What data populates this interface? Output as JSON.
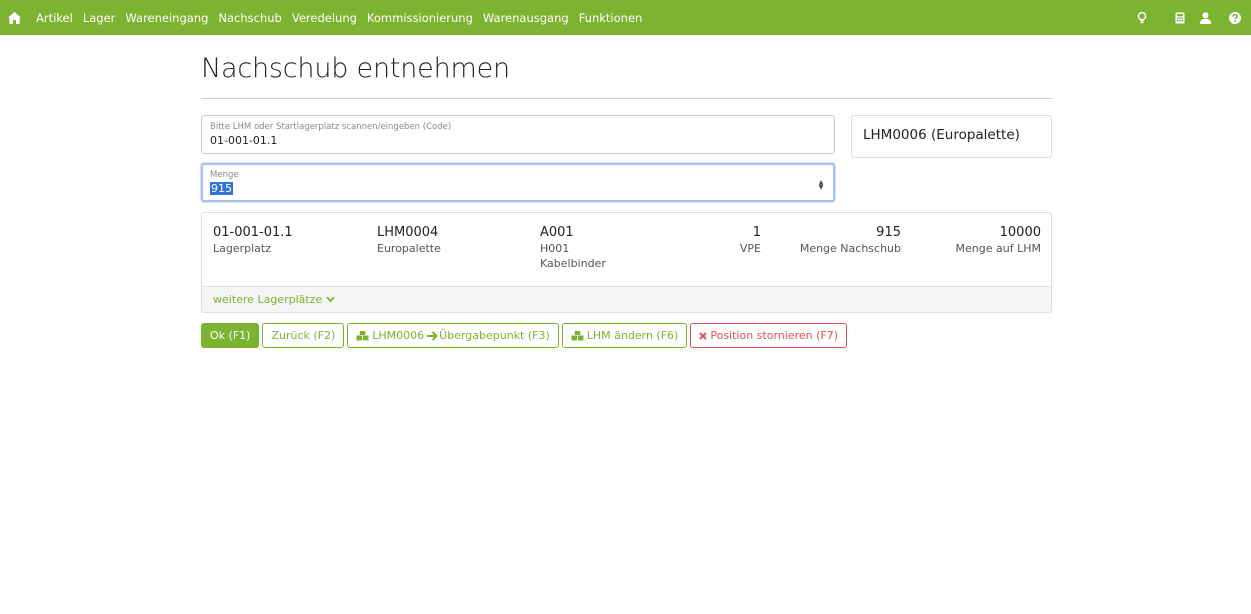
{
  "navbar": {
    "home_icon": "home-icon",
    "items": [
      "Artikel",
      "Lager",
      "Wareneingang",
      "Nachschub",
      "Veredelung",
      "Kommissionierung",
      "Warenausgang",
      "Funktionen"
    ],
    "right_icons": [
      "lightbulb-icon",
      "calculator-icon",
      "user-icon",
      "help-icon"
    ],
    "color": "#7cb330"
  },
  "page": {
    "title": "Nachschub entnehmen"
  },
  "scan_field": {
    "label": "Bitte LHM oder Startlagerplatz scannen/eingeben (Code)",
    "value": "01-001-01.1"
  },
  "menge_field": {
    "label": "Menge",
    "value": "915"
  },
  "lhm_box": {
    "text": "LHM0006 (Europalette)"
  },
  "position": {
    "lagerplatz": "01-001-01.1",
    "lagerplatz_label": "Lagerplatz",
    "lhm": "LHM0004",
    "lhm_label": "Europalette",
    "artikel": "A001",
    "artikel_line2": "H001",
    "artikel_line3": "Kabelbinder",
    "vpe": "1",
    "vpe_label": "VPE",
    "menge_nachschub": "915",
    "menge_nachschub_label": "Menge Nachschub",
    "menge_lhm": "10000",
    "menge_lhm_label": "Menge auf LHM"
  },
  "more_locations": {
    "label": "weitere Lagerplätze"
  },
  "buttons": {
    "ok": "Ok (F1)",
    "back": "Zurück (F2)",
    "transfer_from": "LHM0006",
    "transfer_to": "Übergabepunkt (F3)",
    "change_lhm": "LHM ändern (F6)",
    "cancel_position": "Position stornieren (F7)"
  },
  "colors": {
    "accent": "#7cb330",
    "danger": "#d9534f",
    "focus": "#a8c2ee"
  }
}
